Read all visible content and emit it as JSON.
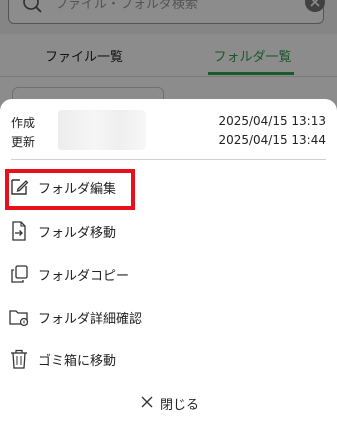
{
  "background": {
    "search": {
      "placeholder": "ファイル・フォルダ検索"
    },
    "tabs": [
      {
        "label": "ファイル一覧"
      },
      {
        "label": "フォルダ一覧"
      }
    ],
    "accent_color": "#2ea34d"
  },
  "sheet": {
    "meta": {
      "created_label": "作成",
      "created_value": "2025/04/15 13:13",
      "updated_label": "更新",
      "updated_value": "2025/04/15 13:44"
    },
    "menu": [
      {
        "label": "フォルダ編集",
        "icon": "edit-icon"
      },
      {
        "label": "フォルダ移動",
        "icon": "move-icon"
      },
      {
        "label": "フォルダコピー",
        "icon": "copy-icon"
      },
      {
        "label": "フォルダ詳細確認",
        "icon": "folder-detail-icon"
      },
      {
        "label": "ゴミ箱に移動",
        "icon": "trash-icon"
      }
    ],
    "close_label": "閉じる",
    "highlight_color": "#e8101a"
  }
}
